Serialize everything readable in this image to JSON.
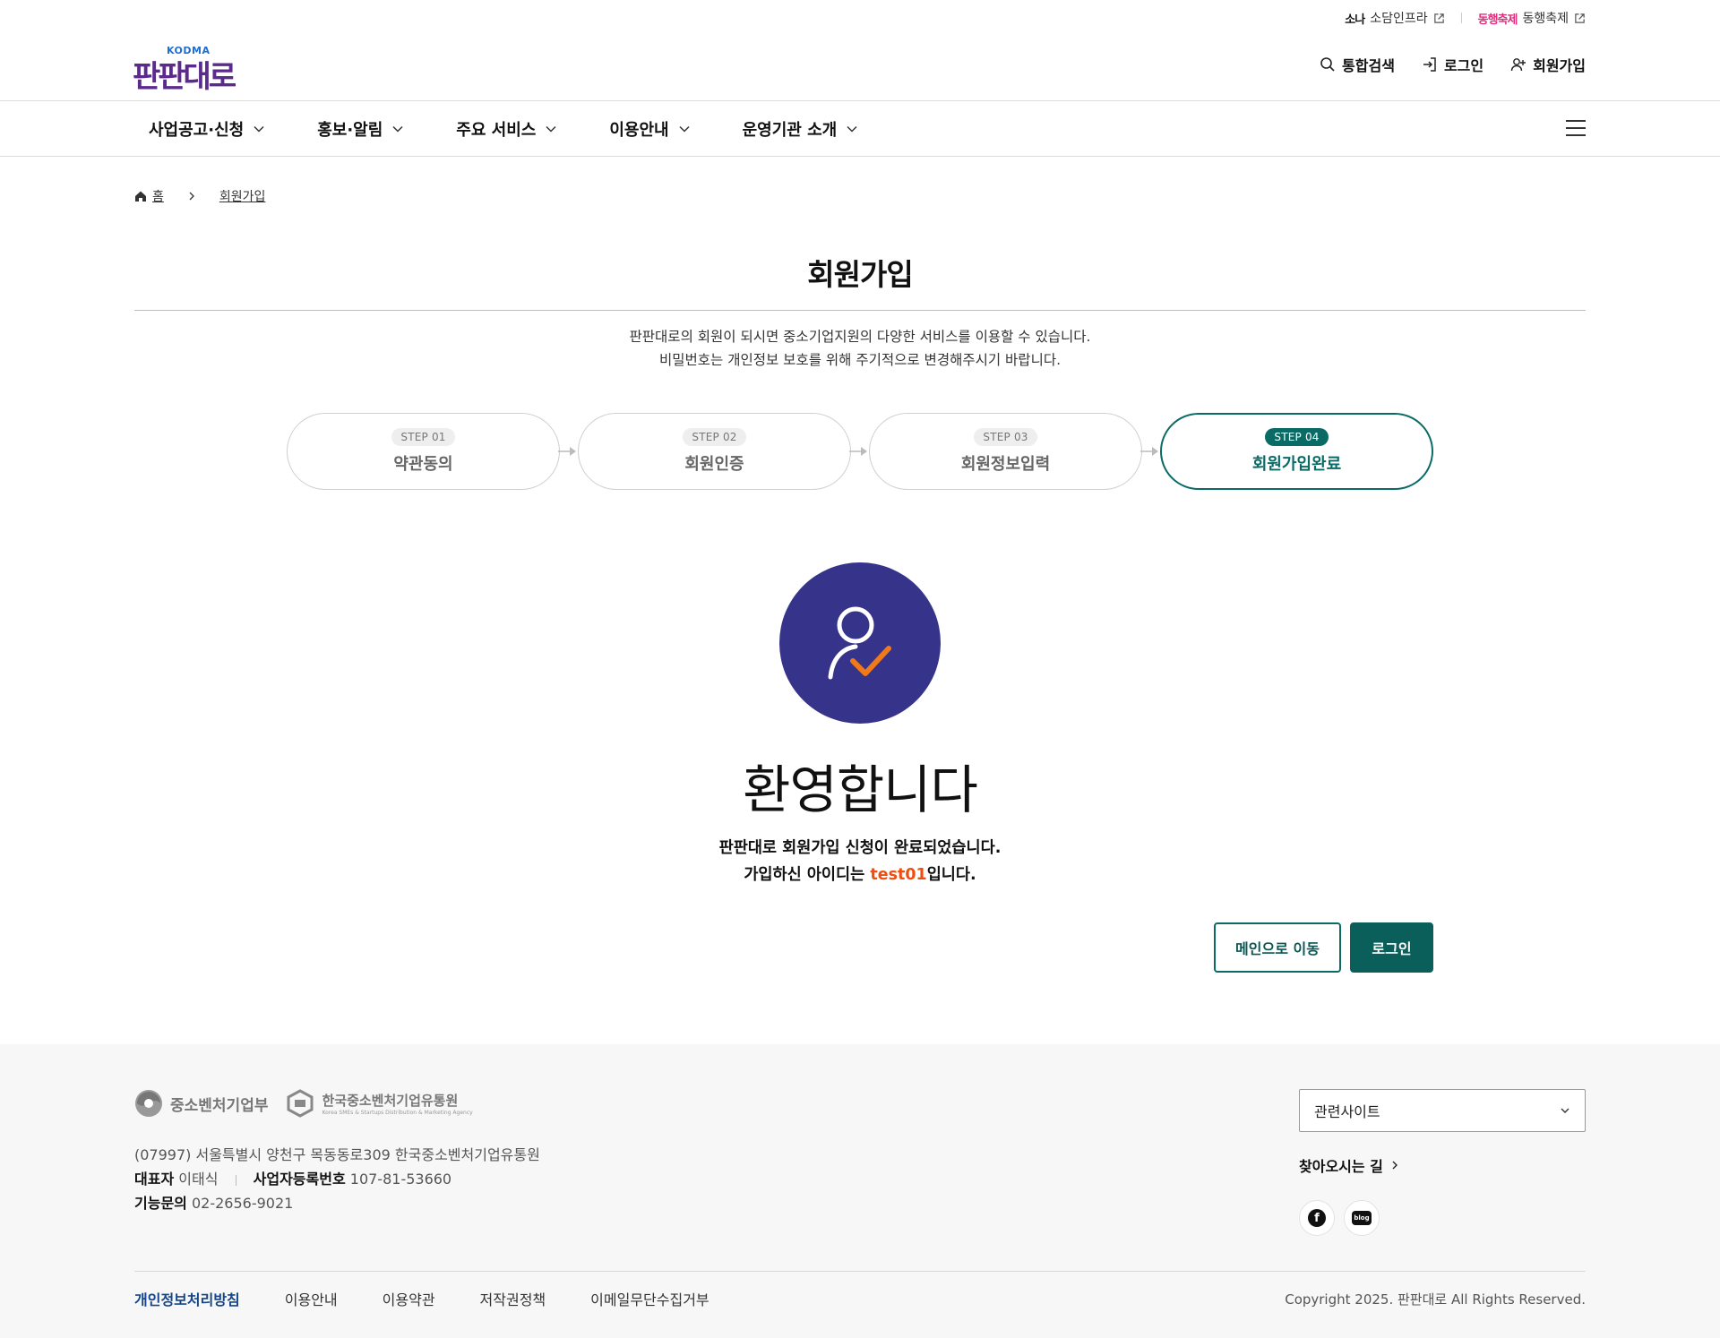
{
  "utility_links": [
    {
      "logo": "소나",
      "label": "소담인프라"
    },
    {
      "logo": "동행축제",
      "label": "동행축제"
    }
  ],
  "logo": {
    "kodma": "KODMA",
    "wordmark": "판판대로"
  },
  "user_menu": {
    "search": "통합검색",
    "login": "로그인",
    "signup": "회원가입"
  },
  "gnb": [
    "사업공고·신청",
    "홍보·알림",
    "주요 서비스",
    "이용안내",
    "운영기관 소개"
  ],
  "breadcrumb": {
    "home": "홈",
    "current": "회원가입"
  },
  "page_title": "회원가입",
  "intro": [
    "판판대로의 회원이 되시면 중소기업지원의 다양한 서비스를 이용할 수 있습니다.",
    "비밀번호는 개인정보 보호를 위해 주기적으로 변경해주시기 바랍니다."
  ],
  "steps": [
    {
      "badge": "STEP 01",
      "label": "약관동의"
    },
    {
      "badge": "STEP 02",
      "label": "회원인증"
    },
    {
      "badge": "STEP 03",
      "label": "회원정보입력"
    },
    {
      "badge": "STEP 04",
      "label": "회원가입완료"
    }
  ],
  "welcome": {
    "title": "환영합니다",
    "line1": "판판대로 회원가입 신청이 완료되었습니다.",
    "line2_prefix": "가입하신 아이디는 ",
    "user_id": "test01",
    "line2_suffix": "입니다."
  },
  "buttons": {
    "main": "메인으로 이동",
    "login": "로그인"
  },
  "footer": {
    "logo1": "중소벤처기업부",
    "logo2_name": "한국중소벤처기업유통원",
    "logo2_sub": "Korea SMEs & Startups Distribution & Marketing Agency",
    "address": "(07997) 서울특별시 양천구 목동동로309 한국중소벤처기업유통원",
    "ceo_label": "대표자",
    "ceo": "이태식",
    "bizno_label": "사업자등록번호",
    "bizno": "107-81-53660",
    "tel_label": "기능문의",
    "tel": "02-2656-9021",
    "related_sites": "관련사이트",
    "directions": "찾아오시는 길",
    "sns": {
      "facebook": "f",
      "blog": "blog"
    },
    "links": [
      "개인정보처리방침",
      "이용안내",
      "이용약관",
      "저작권정책",
      "이메일무단수집거부"
    ],
    "copyright": "Copyright 2025. 판판대로 All Rights Reserved."
  },
  "colors": {
    "primary": "#0a6b66",
    "welcome_circle": "#35338a",
    "check": "#f07a1a",
    "user_id": "#ee4e10",
    "brand": "#5b2a8c"
  }
}
